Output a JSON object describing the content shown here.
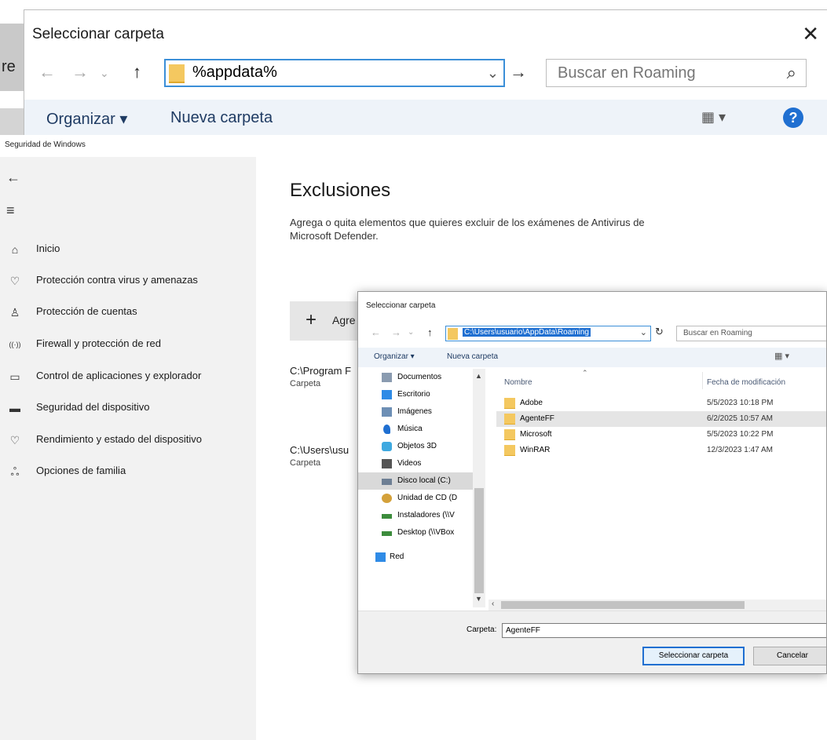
{
  "zoom_dialog": {
    "title": "Seleccionar carpeta",
    "close_glyph": "✕",
    "background_fragment": "re",
    "address_value": "%appdata%",
    "search_placeholder": "Buscar en Roaming",
    "organize_label": "Organizar ▾",
    "new_folder_label": "Nueva carpeta",
    "view_glyph": "▦ ▾",
    "help_glyph": "?"
  },
  "app": {
    "title": "Seguridad de Windows",
    "back_glyph": "←",
    "menu_glyph": "≡",
    "nav": [
      {
        "label": "Inicio",
        "icon": "⌂"
      },
      {
        "label": "Protección contra virus y amenazas",
        "icon": "♡"
      },
      {
        "label": "Protección de cuentas",
        "icon": "♙"
      },
      {
        "label": "Firewall y protección de red",
        "icon": "((·))"
      },
      {
        "label": "Control de aplicaciones y explorador",
        "icon": "▭"
      },
      {
        "label": "Seguridad del dispositivo",
        "icon": "▬"
      },
      {
        "label": "Rendimiento y estado del dispositivo",
        "icon": "♡"
      },
      {
        "label": "Opciones de familia",
        "icon": "ஃ"
      }
    ]
  },
  "content": {
    "heading": "Exclusiones",
    "description": "Agrega o quita elementos que quieres excluir de los exámenes de Antivirus de Microsoft Defender.",
    "add_button_plus": "+",
    "add_button_label": "Agre",
    "exclusions": [
      {
        "path": "C:\\Program F",
        "type": "Carpeta"
      },
      {
        "path": "C:\\Users\\usu",
        "type": "Carpeta"
      }
    ]
  },
  "small_dialog": {
    "title": "Seleccionar carpeta",
    "address_value": "C:\\Users\\usuario\\AppData\\Roaming",
    "refresh_glyph": "↻",
    "search_placeholder": "Buscar en Roaming",
    "organize_label": "Organizar ▾",
    "new_folder_label": "Nueva carpeta",
    "view_glyph": "▦ ▾",
    "tree": [
      {
        "label": "Documentos",
        "icon": "documents-icon",
        "color": "#8a9bb0"
      },
      {
        "label": "Escritorio",
        "icon": "desktop-icon",
        "color": "#2f8be6"
      },
      {
        "label": "Imágenes",
        "icon": "pictures-icon",
        "color": "#6d8fb5"
      },
      {
        "label": "Música",
        "icon": "music-icon",
        "color": "#1f6fd1"
      },
      {
        "label": "Objetos 3D",
        "icon": "objects3d-icon",
        "color": "#3fa9e0"
      },
      {
        "label": "Videos",
        "icon": "videos-icon",
        "color": "#555555"
      },
      {
        "label": "Disco local (C:)",
        "icon": "disk-icon",
        "color": "#6e7f94"
      },
      {
        "label": "Unidad de CD (D",
        "icon": "cd-icon",
        "color": "#d4a13a"
      },
      {
        "label": "Instaladores (\\\\V",
        "icon": "network-drive-icon",
        "color": "#3c8c3c"
      },
      {
        "label": "Desktop (\\\\VBox",
        "icon": "network-drive-icon",
        "color": "#3c8c3c"
      },
      {
        "label": "Red",
        "icon": "network-icon",
        "color": "#2f8be6"
      }
    ],
    "columns": {
      "name": "Nombre",
      "date": "Fecha de modificación"
    },
    "rows": [
      {
        "name": "Adobe",
        "date": "5/5/2023 10:18 PM"
      },
      {
        "name": "AgenteFF",
        "date": "6/2/2025 10:57 AM"
      },
      {
        "name": "Microsoft",
        "date": "5/5/2023 10:22 PM"
      },
      {
        "name": "WinRAR",
        "date": "12/3/2023 1:47 AM"
      }
    ],
    "folder_label": "Carpeta:",
    "folder_value": "AgenteFF",
    "select_button": "Seleccionar carpeta",
    "cancel_button": "Cancelar"
  }
}
